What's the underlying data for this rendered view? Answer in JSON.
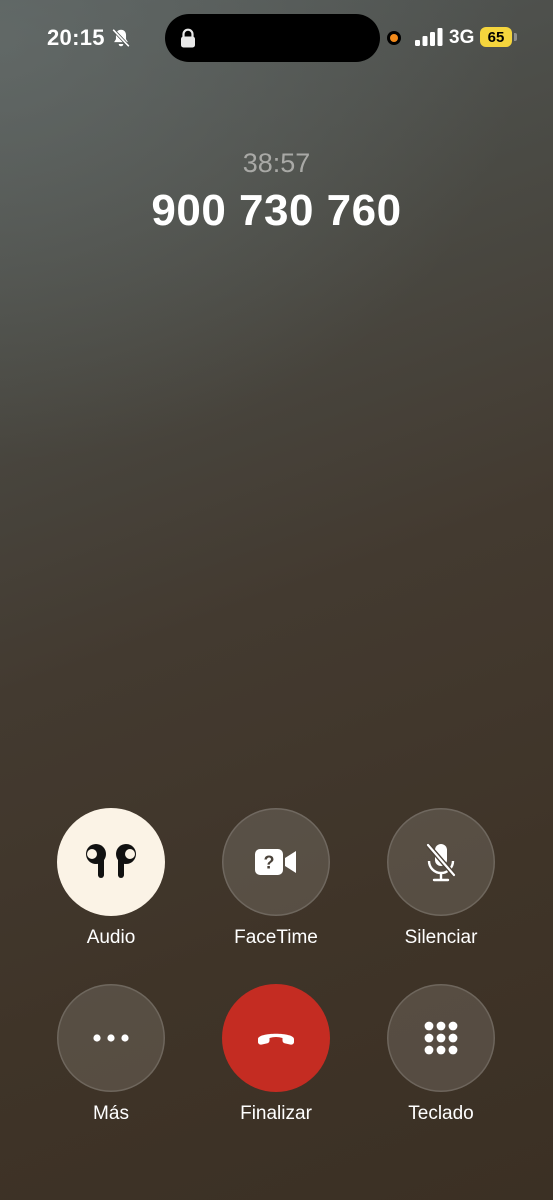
{
  "status_bar": {
    "time": "20:15",
    "network": "3G",
    "battery": "65",
    "icons": [
      "bell-slash-icon",
      "lock-icon",
      "recording-indicator",
      "signal-icon",
      "battery-icon"
    ],
    "battery_color": "#f5d53d",
    "recording_color": "#f28a1a"
  },
  "call": {
    "duration": "38:57",
    "number": "900 730 760"
  },
  "controls": {
    "audio": {
      "label": "Audio",
      "icon": "airpods-icon",
      "active": true
    },
    "facetime": {
      "label": "FaceTime",
      "icon": "facetime-video-icon"
    },
    "mute": {
      "label": "Silenciar",
      "icon": "microphone-slash-icon"
    },
    "more": {
      "label": "Más",
      "icon": "ellipsis-icon"
    },
    "end": {
      "label": "Finalizar",
      "icon": "end-call-icon",
      "color": "#c42c22"
    },
    "keypad": {
      "label": "Teclado",
      "icon": "keypad-icon"
    }
  }
}
